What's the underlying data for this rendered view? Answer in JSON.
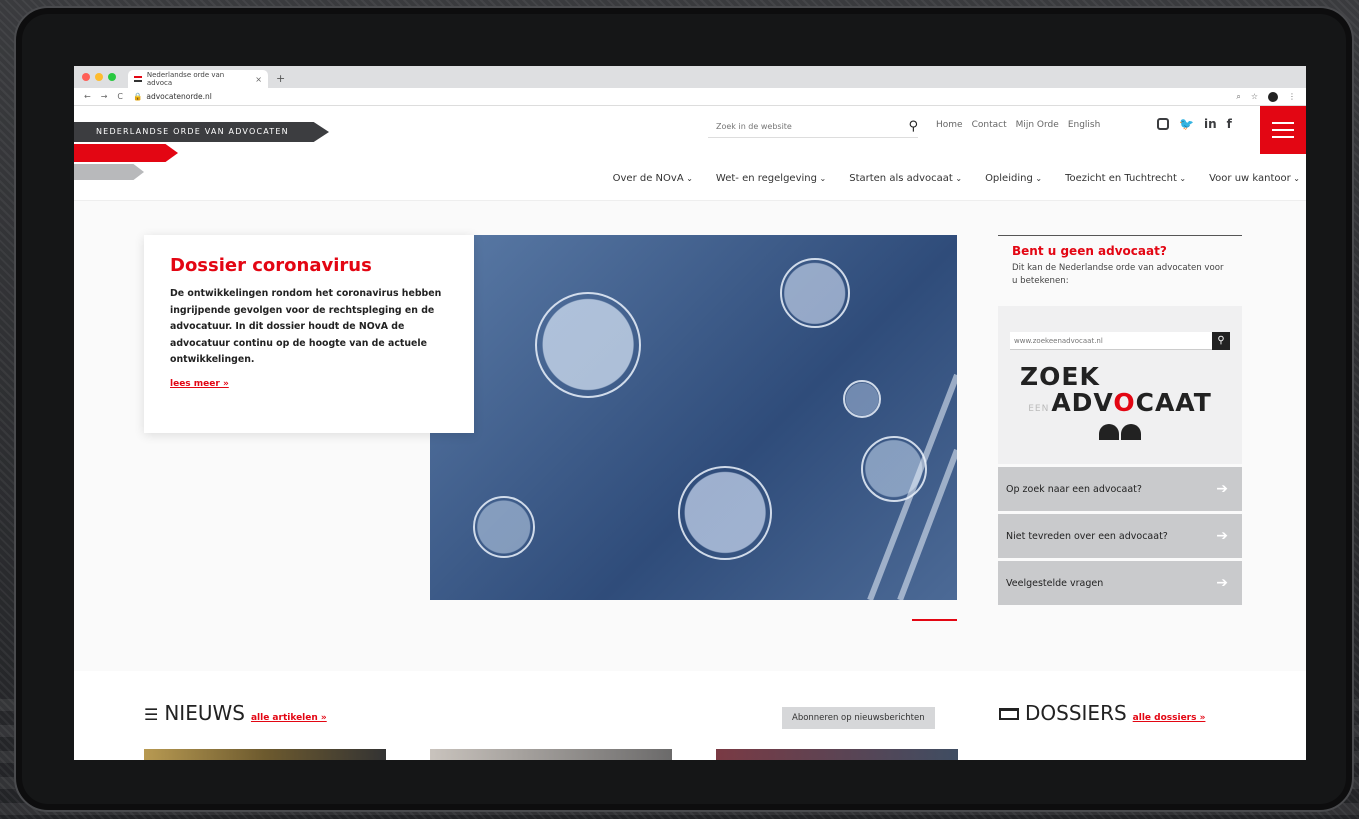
{
  "browser": {
    "tab_title": "Nederlandse orde van advoca",
    "tab_close": "×",
    "new_tab": "+",
    "url": "advocatenorde.nl"
  },
  "header": {
    "brand": "NEDERLANDSE ORDE VAN ADVOCATEN",
    "search_placeholder": "Zoek in de website",
    "toplinks": [
      "Home",
      "Contact",
      "Mijn Orde",
      "English"
    ],
    "socials": [
      "instagram-icon",
      "twitter-icon",
      "linkedin-icon",
      "facebook-icon"
    ],
    "nav": [
      "Over de NOvA",
      "Wet- en regelgeving",
      "Starten als advocaat",
      "Opleiding",
      "Toezicht en Tuchtrecht",
      "Voor uw kantoor"
    ],
    "accent": "#e30613"
  },
  "hero": {
    "title": "Dossier coronavirus",
    "body": "De ontwikkelingen rondom het coronavirus hebben ingrijpende gevolgen voor de rechtspleging en de advocatuur. In dit dossier houdt de NOvA de advocatuur continu op de hoogte van de actuele ontwikkelingen.",
    "link": "lees meer »"
  },
  "sidebar": {
    "title": "Bent u geen advocaat?",
    "subtitle": "Dit kan de Nederlandse orde van advocaten voor u betekenen:",
    "search_placeholder": "www.zoekeenadvocaat.nl",
    "logo_line1": "ZOEK",
    "logo_een": "EEN",
    "logo_line2_a": "ADV",
    "logo_line2_o": "O",
    "logo_line2_b": "CAAT",
    "buttons": [
      "Op zoek naar een advocaat?",
      "Niet tevreden over een advocaat?",
      "Veelgestelde vragen"
    ]
  },
  "lower": {
    "news_title": "NIEUWS",
    "news_link": "alle artikelen »",
    "subscribe": "Abonneren op nieuwsberichten",
    "dossiers_title": "DOSSIERS",
    "dossiers_link": "alle dossiers »"
  }
}
